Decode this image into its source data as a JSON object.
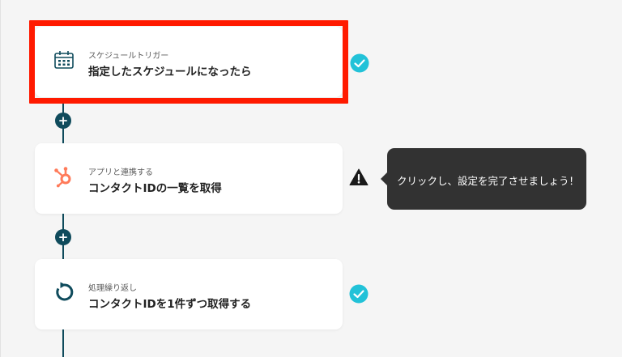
{
  "flow": {
    "steps": [
      {
        "label": "スケジュールトリガー",
        "title": "指定したスケジュールになったら",
        "icon": "calendar-schedule-icon",
        "status": "complete"
      },
      {
        "label": "アプリと連携する",
        "title": "コンタクトIDの一覧を取得",
        "icon": "hubspot-icon",
        "status": "warning"
      },
      {
        "label": "処理繰り返し",
        "title": "コンタクトIDを1件ずつ取得する",
        "icon": "loop-icon",
        "status": "complete"
      }
    ],
    "add_label": "+"
  },
  "tooltip": {
    "text": "クリックし、設定を完了させましょう！"
  },
  "colors": {
    "background": "#f5f5f5",
    "connector": "#0f4b5c",
    "highlight": "#ff1a00",
    "check": "#22c2d8",
    "hubspot": "#ff7a59",
    "tooltip_bg": "#323232"
  }
}
